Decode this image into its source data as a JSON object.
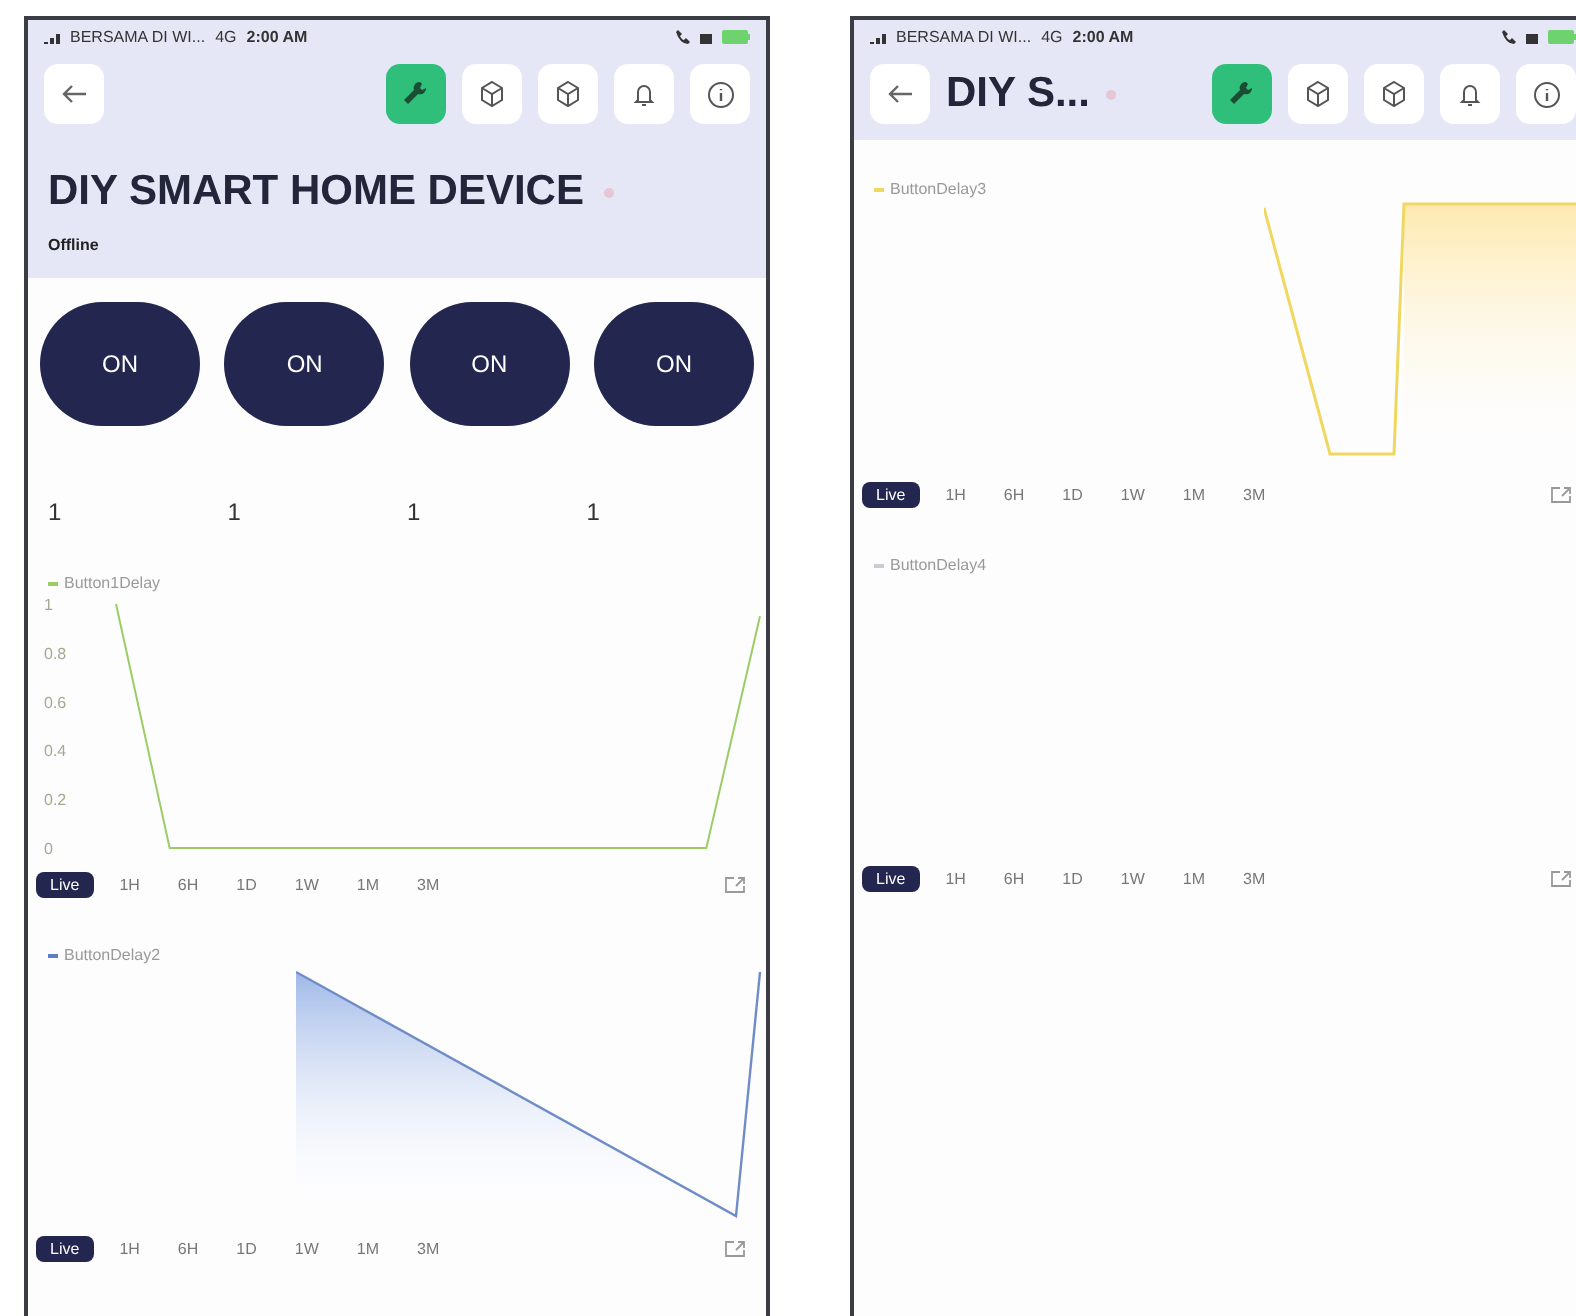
{
  "screens": [
    {
      "status_bar": {
        "carrier": "BERSAMA DI WI...",
        "network": "4G",
        "time": "2:00 AM"
      },
      "header": {
        "kind": "large",
        "title": "DIY SMART HOME DEVICE",
        "status": "Offline",
        "tools": [
          {
            "kind": "wrench",
            "selected": true
          },
          {
            "kind": "cube",
            "selected": false
          },
          {
            "kind": "cube",
            "selected": false
          },
          {
            "kind": "bell",
            "selected": false
          },
          {
            "kind": "info",
            "selected": false
          }
        ]
      },
      "widgets": [
        {
          "kind": "buttons",
          "labels": [
            "ON",
            "ON",
            "ON",
            "ON"
          ]
        },
        {
          "kind": "values",
          "values": [
            "1",
            "1",
            "1",
            "1"
          ]
        },
        {
          "kind": "line",
          "color": "#9ccc65",
          "chart_data": {
            "type": "line",
            "categories": [
              null,
              null,
              null,
              null,
              null,
              null,
              null,
              null,
              null,
              null,
              null,
              null,
              null
            ],
            "series": [
              {
                "name": "Button1Delay",
                "color": "#9ccc65",
                "values": [
                  1,
                  0,
                  0,
                  0,
                  0,
                  0,
                  0,
                  0,
                  0,
                  0,
                  0,
                  0,
                  0.95
                ]
              }
            ],
            "ylim": [
              0,
              1
            ],
            "yticks": [
              0,
              0.2,
              0.4,
              0.6,
              0.8,
              1
            ]
          }
        },
        {
          "kind": "range",
          "items": [
            {
              "label": "Live",
              "selected": true
            },
            {
              "label": "1H",
              "selected": false
            },
            {
              "label": "6H",
              "selected": false
            },
            {
              "label": "1D",
              "selected": false
            },
            {
              "label": "1W",
              "selected": false
            },
            {
              "label": "1M",
              "selected": false
            },
            {
              "label": "3M",
              "selected": false
            }
          ]
        },
        {
          "kind": "falling-trace",
          "legend": "ButtonDelay2",
          "color": "#5b7fc4"
        },
        {
          "kind": "range",
          "items": [
            {
              "label": "Live",
              "selected": true
            },
            {
              "label": "1H",
              "selected": false
            },
            {
              "label": "6H",
              "selected": false
            },
            {
              "label": "1D",
              "selected": false
            },
            {
              "label": "1W",
              "selected": false
            },
            {
              "label": "1M",
              "selected": false
            },
            {
              "label": "3M",
              "selected": false
            }
          ]
        }
      ]
    },
    {
      "status_bar": {
        "carrier": "BERSAMA DI WI...",
        "network": "4G",
        "time": "2:00 AM"
      },
      "header": {
        "kind": "inline",
        "title": "DIY S...",
        "tools": [
          {
            "kind": "wrench",
            "selected": true
          },
          {
            "kind": "cube",
            "selected": false
          },
          {
            "kind": "cube",
            "selected": false
          },
          {
            "kind": "bell",
            "selected": false
          },
          {
            "kind": "info",
            "selected": false
          }
        ]
      },
      "widgets": [
        {
          "kind": "dip-trace",
          "legend": "ButtonDelay3",
          "color": "#f0d860"
        },
        {
          "kind": "range",
          "items": [
            {
              "label": "Live",
              "selected": true
            },
            {
              "label": "1H",
              "selected": false
            },
            {
              "label": "6H",
              "selected": false
            },
            {
              "label": "1D",
              "selected": false
            },
            {
              "label": "1W",
              "selected": false
            },
            {
              "label": "1M",
              "selected": false
            },
            {
              "label": "3M",
              "selected": false
            }
          ]
        },
        {
          "kind": "blank",
          "legend": "ButtonDelay4",
          "color": "#c8ccd6"
        },
        {
          "kind": "range",
          "items": [
            {
              "label": "Live",
              "selected": true
            },
            {
              "label": "1H",
              "selected": false
            },
            {
              "label": "6H",
              "selected": false
            },
            {
              "label": "1D",
              "selected": false
            },
            {
              "label": "1W",
              "selected": false
            },
            {
              "label": "1M",
              "selected": false
            },
            {
              "label": "3M",
              "selected": false
            }
          ]
        }
      ]
    }
  ]
}
